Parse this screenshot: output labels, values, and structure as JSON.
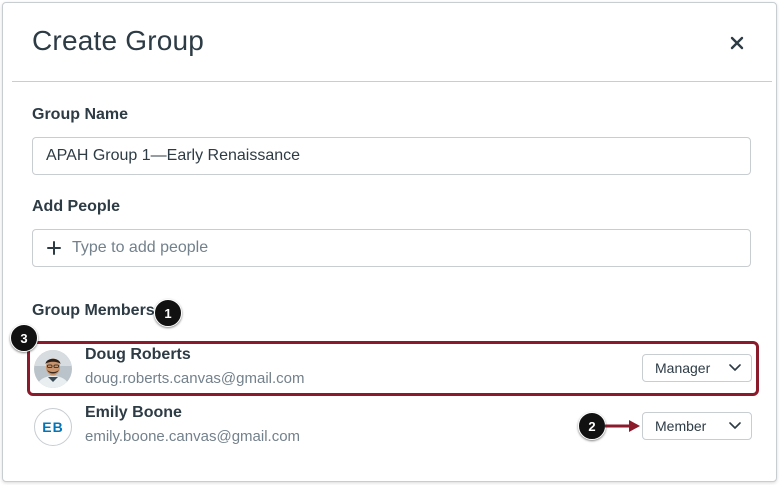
{
  "modal": {
    "title": "Create Group",
    "close_icon": "close-icon"
  },
  "group_name": {
    "label": "Group Name",
    "value": "APAH Group 1—Early Renaissance"
  },
  "add_people": {
    "label": "Add People",
    "placeholder": "Type to add people",
    "icon": "plus-icon"
  },
  "group_members": {
    "label": "Group Members",
    "members": [
      {
        "name": "Doug Roberts",
        "email": "doug.roberts.canvas@gmail.com",
        "role": "Manager",
        "avatar": "photo"
      },
      {
        "name": "Emily Boone",
        "email": "emily.boone.canvas@gmail.com",
        "role": "Member",
        "initials": "EB"
      }
    ]
  },
  "callouts": {
    "one": "1",
    "two": "2",
    "three": "3"
  },
  "colors": {
    "highlight": "#8b1a2b",
    "accent": "#0374b5",
    "text": "#2d3b45",
    "muted": "#73818c",
    "border": "#c7cdd1"
  }
}
